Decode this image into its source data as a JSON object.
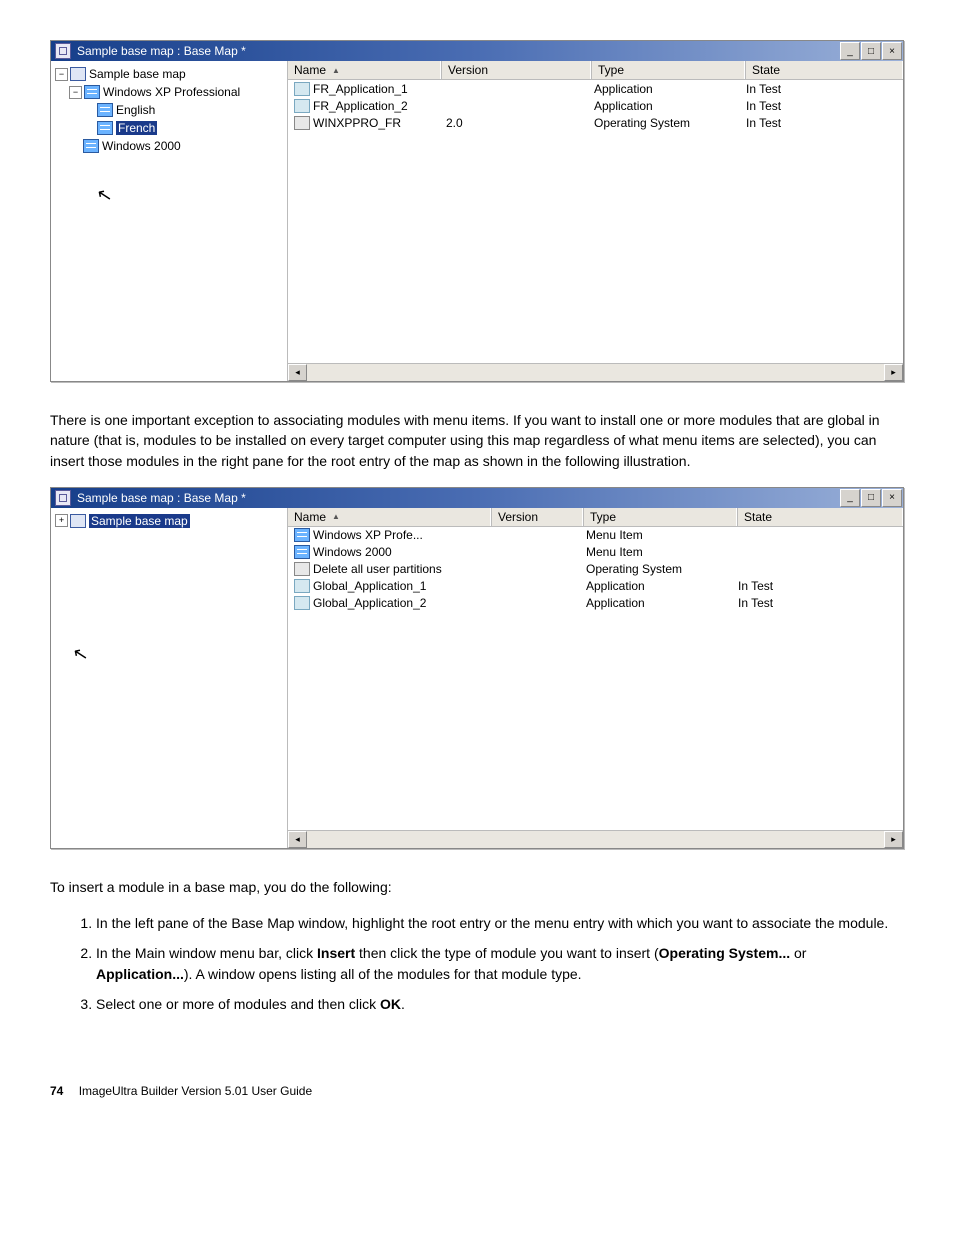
{
  "window1": {
    "title": "Sample base map : Base Map *",
    "tree": {
      "root": "Sample base map",
      "n1": "Windows XP Professional",
      "n1a": "English",
      "n1b": "French",
      "n2": "Windows 2000"
    },
    "headers": {
      "name": "Name",
      "version": "Version",
      "type": "Type",
      "state": "State"
    },
    "rows": [
      {
        "name": "FR_Application_1",
        "version": "",
        "type": "Application",
        "state": "In Test",
        "icon": "app"
      },
      {
        "name": "FR_Application_2",
        "version": "",
        "type": "Application",
        "state": "In Test",
        "icon": "app"
      },
      {
        "name": "WINXPPRO_FR",
        "version": "2.0",
        "type": "Operating System",
        "state": "In Test",
        "icon": "os"
      }
    ]
  },
  "para1": "There is one important exception to associating modules with menu items. If you want to install one or more modules that are global in nature (that is, modules to be installed on every target computer using this map regardless of what menu items are selected), you can insert those modules in the right pane for the root entry of the map as shown in the following illustration.",
  "window2": {
    "title": "Sample base map : Base Map *",
    "tree": {
      "root": "Sample base map"
    },
    "headers": {
      "name": "Name",
      "version": "Version",
      "type": "Type",
      "state": "State"
    },
    "rows": [
      {
        "name": "Windows XP Profe...",
        "version": "",
        "type": "Menu Item",
        "state": "",
        "icon": "menu"
      },
      {
        "name": "Windows 2000",
        "version": "",
        "type": "Menu Item",
        "state": "",
        "icon": "menu"
      },
      {
        "name": "Delete all user partitions",
        "version": "",
        "type": "Operating System",
        "state": "",
        "icon": "os"
      },
      {
        "name": "Global_Application_1",
        "version": "",
        "type": "Application",
        "state": "In Test",
        "icon": "app"
      },
      {
        "name": "Global_Application_2",
        "version": "",
        "type": "Application",
        "state": "In Test",
        "icon": "app"
      }
    ]
  },
  "para2": "To insert a module in a base map, you do the following:",
  "steps": {
    "s1": "In the left pane of the Base Map window, highlight the root entry or the menu entry with which you want to associate the module.",
    "s2a": "In the Main window menu bar, click ",
    "s2b": "Insert",
    "s2c": " then click the type of module you want to insert (",
    "s2d": "Operating System...",
    "s2e": " or ",
    "s2f": "Application...",
    "s2g": "). A window opens listing all of the modules for that module type.",
    "s3a": "Select one or more of modules and then click ",
    "s3b": "OK",
    "s3c": "."
  },
  "footer": {
    "page": "74",
    "text": "ImageUltra Builder Version 5.01 User Guide"
  }
}
